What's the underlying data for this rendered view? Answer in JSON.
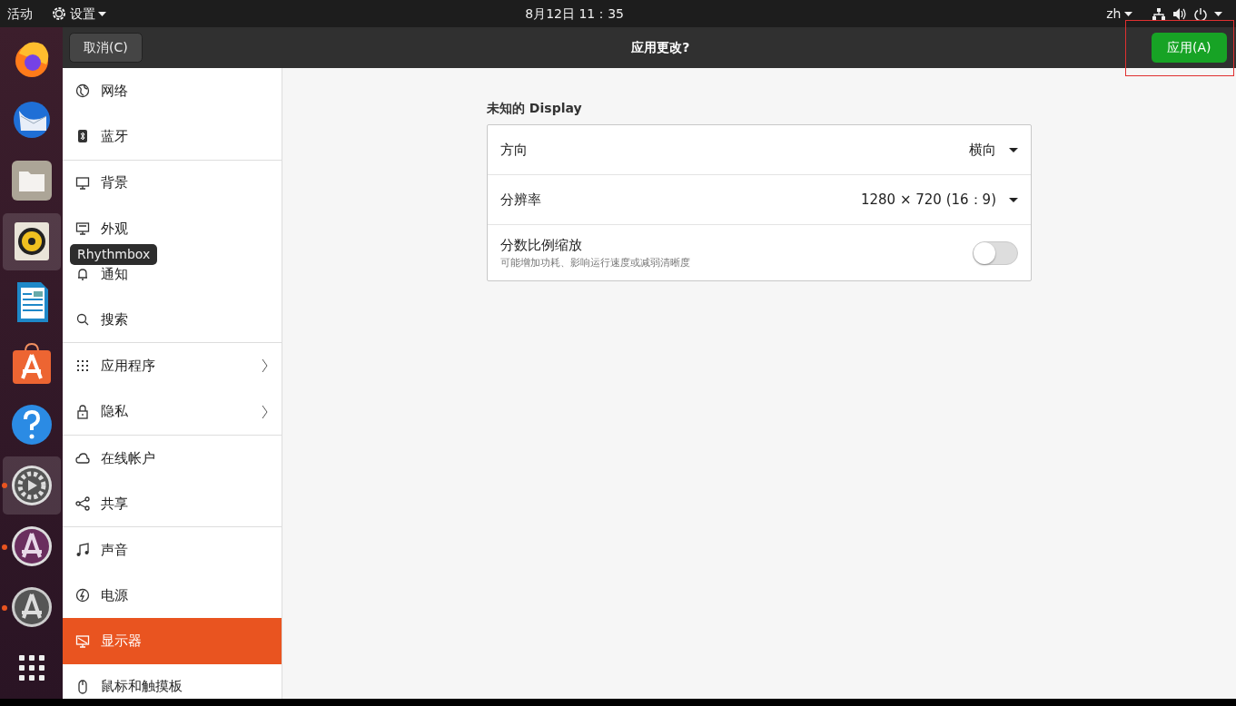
{
  "top_bar": {
    "activities": "活动",
    "app_menu": "设置",
    "clock": "8月12日  11：35",
    "language": "zh"
  },
  "dock": [
    {
      "selected": false,
      "running": false
    },
    {
      "selected": false,
      "running": false
    },
    {
      "selected": false,
      "running": false
    },
    {
      "selected": true,
      "running": false
    },
    {
      "selected": false,
      "running": false
    },
    {
      "selected": false,
      "running": false
    },
    {
      "selected": false,
      "running": false
    },
    {
      "selected": true,
      "running": true
    },
    {
      "selected": false,
      "running": true
    },
    {
      "selected": false,
      "running": true
    },
    {
      "selected": false,
      "running": false
    }
  ],
  "tooltip": "Rhythmbox",
  "header": {
    "cancel": "取消(C)",
    "title": "应用更改?",
    "apply": "应用(A)"
  },
  "sidebar": {
    "groups": [
      [
        {
          "label": "网络",
          "arrow": false,
          "selected": false
        },
        {
          "label": "蓝牙",
          "arrow": false,
          "selected": false
        }
      ],
      [
        {
          "label": "背景",
          "arrow": false,
          "selected": false
        },
        {
          "label": "外观",
          "arrow": false,
          "selected": false
        },
        {
          "label": "通知",
          "arrow": false,
          "selected": false
        },
        {
          "label": "搜索",
          "arrow": false,
          "selected": false
        }
      ],
      [
        {
          "label": "应用程序",
          "arrow": true,
          "selected": false
        },
        {
          "label": "隐私",
          "arrow": true,
          "selected": false
        }
      ],
      [
        {
          "label": "在线帐户",
          "arrow": false,
          "selected": false
        },
        {
          "label": "共享",
          "arrow": false,
          "selected": false
        }
      ],
      [
        {
          "label": "声音",
          "arrow": false,
          "selected": false
        },
        {
          "label": "电源",
          "arrow": false,
          "selected": false
        },
        {
          "label": "显示器",
          "arrow": false,
          "selected": true
        },
        {
          "label": "鼠标和触摸板",
          "arrow": false,
          "selected": false
        }
      ]
    ]
  },
  "display": {
    "title": "未知的 Display",
    "rows": [
      {
        "kind": "dropdown",
        "label": "方向",
        "value": "横向"
      },
      {
        "kind": "dropdown",
        "label": "分辨率",
        "value": "1280 × 720 (16：9)"
      },
      {
        "kind": "switch",
        "label": "分数比例缩放",
        "hint": "可能增加功耗、影响运行速度或减弱清晰度",
        "on": false
      }
    ]
  }
}
